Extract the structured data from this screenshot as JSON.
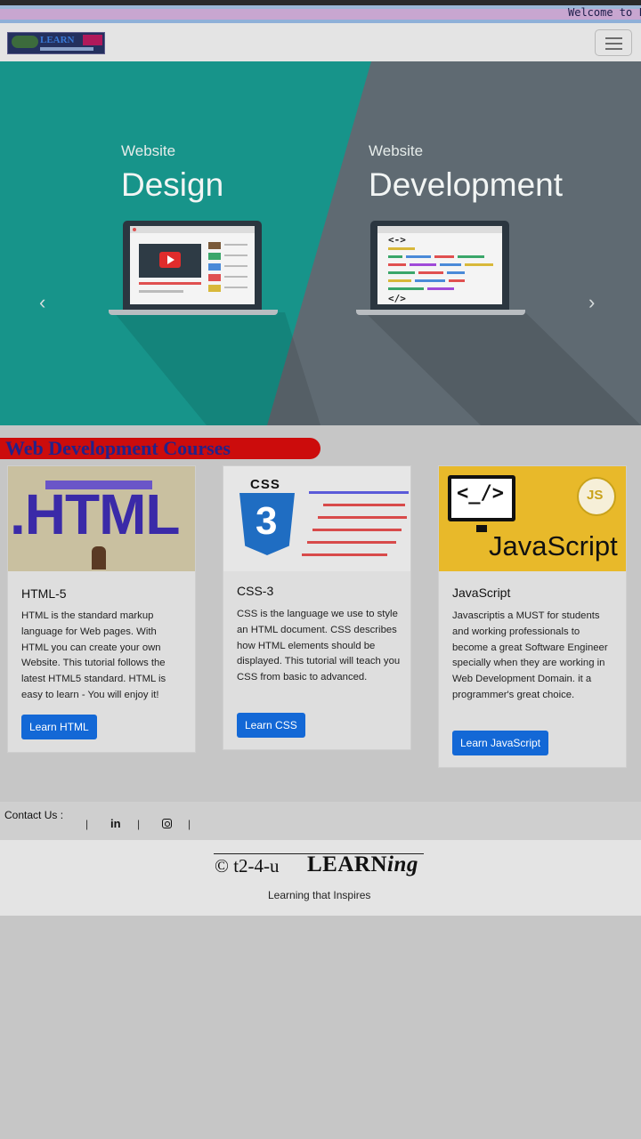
{
  "marquee": "Welcome to F",
  "hero": {
    "left_sub": "Website",
    "left_title": "Design",
    "right_sub": "Website",
    "right_title": "Development",
    "code_open": "<->",
    "code_close": "</>",
    "prev": "‹",
    "next": "›"
  },
  "section_title": "Web Development Courses",
  "cards": [
    {
      "image_text": ".HTML",
      "title": "HTML-5",
      "desc": "HTML is the standard markup language for Web pages. With HTML you can create your own Website. This tutorial follows the latest HTML5 standard. HTML is easy to learn - You will enjoy it!",
      "button": "Learn HTML"
    },
    {
      "image_text": "CSS",
      "image_number": "3",
      "title": "CSS-3",
      "desc": "CSS is the language we use to style an HTML document. CSS describes how HTML elements should be displayed. This tutorial will teach you CSS from basic to advanced.",
      "button": "Learn CSS"
    },
    {
      "image_text": "JavaScript",
      "image_badge": "JS",
      "image_code": "<_/>",
      "title": "JavaScript",
      "desc": "Javascriptis a MUST for students and working professionals to become a great Software Engineer specially when they are working in Web Development Domain. it a programmer's great choice.",
      "button": "Learn JavaScript"
    }
  ],
  "contact": {
    "label": "Contact Us :",
    "linkedin": "in",
    "separator": "|"
  },
  "footer": {
    "copy": "© t2-4-u",
    "brand_main": "LEARN",
    "brand_italic": "ing",
    "tagline": "Learning that Inspires"
  },
  "colors": {
    "hero_teal": "#17948a",
    "hero_gray": "#5f6a72",
    "button_blue": "#1368d6",
    "section_red": "#cc0c0c",
    "section_text": "#22228a",
    "js_yellow": "#e8b92a"
  }
}
